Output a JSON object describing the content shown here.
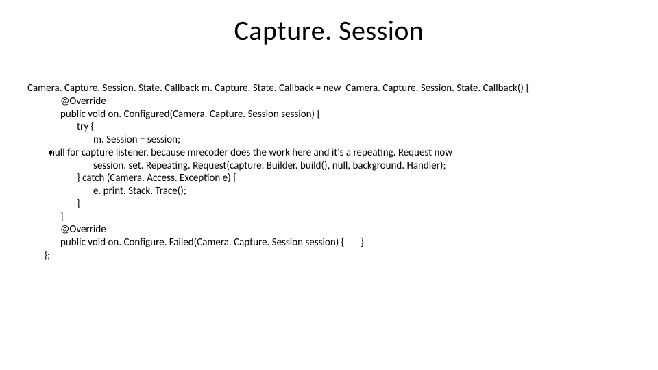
{
  "title": "Capture. Session",
  "code": {
    "l1": "Camera. Capture. Session. State. Callback m. Capture. State. Callback = new  Camera. Capture. Session. State. Callback() {",
    "l2": "@Override",
    "l3": "public void on. Configured(Camera. Capture. Session session) {",
    "l4": "try {",
    "l5": "m. Session = session;",
    "bullet_l6": "null for capture listener, because mrecoder does the work here and it's a repeating. Request now",
    "l7": "session. set. Repeating. Request(capture. Builder. build(), null, background. Handler);",
    "l8": "} catch (Camera. Access. Exception e) {",
    "l9": "e. print. Stack. Trace();",
    "l10": "}",
    "l11": "}",
    "l12": "@Override",
    "l13": "public void on. Configure. Failed(Camera. Capture. Session session) {       }",
    "l14": "};"
  }
}
